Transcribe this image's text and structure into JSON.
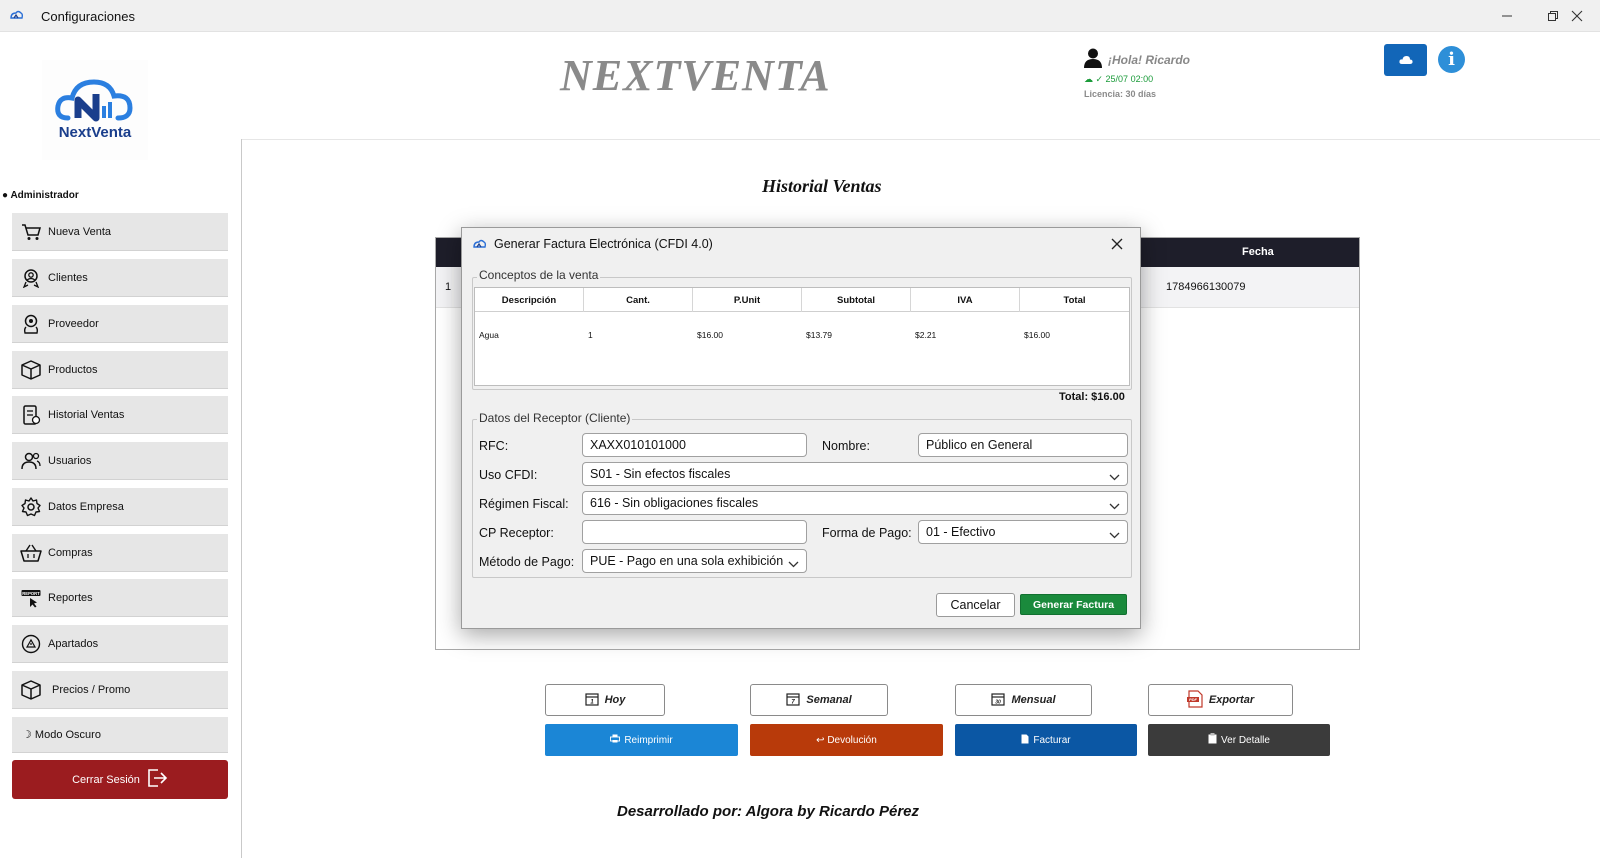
{
  "window": {
    "title": "Configuraciones"
  },
  "header": {
    "brand": "NEXTVENTA",
    "logo_text": "NextVenta",
    "greeting": "¡Hola! Ricardo",
    "sync_status": "☁ ✓ 25/07 02:00",
    "license": "Licencia: 30 días",
    "info_label": "i"
  },
  "sidebar": {
    "role": "● Administrador",
    "items": [
      {
        "label": "Nueva Venta",
        "icon": "cart-icon"
      },
      {
        "label": "Clientes",
        "icon": "clients-icon"
      },
      {
        "label": "Proveedor",
        "icon": "supplier-icon"
      },
      {
        "label": "Productos",
        "icon": "box-icon"
      },
      {
        "label": "Historial Ventas",
        "icon": "history-icon"
      },
      {
        "label": "Usuarios",
        "icon": "users-icon"
      },
      {
        "label": "Datos Empresa",
        "icon": "gear-icon"
      },
      {
        "label": "Compras",
        "icon": "basket-icon"
      },
      {
        "label": "Reportes",
        "icon": "report-icon"
      },
      {
        "label": "Apartados",
        "icon": "layaway-icon"
      },
      {
        "label": "Precios / Promo",
        "icon": "box-icon"
      },
      {
        "label": "☽ Modo Oscuro",
        "icon": "moon-icon"
      }
    ],
    "logout_label": "Cerrar Sesión"
  },
  "main": {
    "title": "Historial Ventas",
    "table": {
      "columns": [
        "",
        "Fecha"
      ],
      "rows": [
        {
          "num": "1",
          "folio": "1784966130079"
        }
      ]
    },
    "filters": [
      {
        "label": "Hoy"
      },
      {
        "label": "Semanal"
      },
      {
        "label": "Mensual"
      },
      {
        "label": "Exportar"
      }
    ],
    "actions": [
      {
        "label": "Reimprimir",
        "color": "#1b86d6"
      },
      {
        "label": "↩ Devolución",
        "color": "#b83a0a"
      },
      {
        "label": "Facturar",
        "color": "#0b57a4"
      },
      {
        "label": "Ver Detalle",
        "color": "#3b3b3b"
      }
    ],
    "credit": "Desarrollado por: Algora by Ricardo Pérez"
  },
  "dialog": {
    "title": "Generar Factura Electrónica (CFDI 4.0)",
    "concepts_label": "Conceptos de la venta",
    "columns": [
      "Descripción",
      "Cant.",
      "P.Unit",
      "Subtotal",
      "IVA",
      "Total"
    ],
    "rows": [
      {
        "descripcion": "Agua",
        "cant": "1",
        "punit": "$16.00",
        "subtotal": "$13.79",
        "iva": "$2.21",
        "total": "$16.00"
      }
    ],
    "total": "Total: $16.00",
    "receptor_label": "Datos del Receptor (Cliente)",
    "rfc_label": "RFC:",
    "rfc_value": "XAXX010101000",
    "nombre_label": "Nombre:",
    "nombre_value": "Público en General",
    "uso_label": "Uso CFDI:",
    "uso_value": "S01 - Sin efectos fiscales",
    "regimen_label": "Régimen Fiscal:",
    "regimen_value": "616 - Sin obligaciones fiscales",
    "cp_label": "CP Receptor:",
    "cp_value": "",
    "forma_label": "Forma de Pago:",
    "forma_value": "01 - Efectivo",
    "metodo_label": "Método de Pago:",
    "metodo_value": "PUE - Pago en una sola exhibición",
    "cancel_label": "Cancelar",
    "generate_label": "Generar Factura",
    "generate_color": "#1a8a3c"
  }
}
